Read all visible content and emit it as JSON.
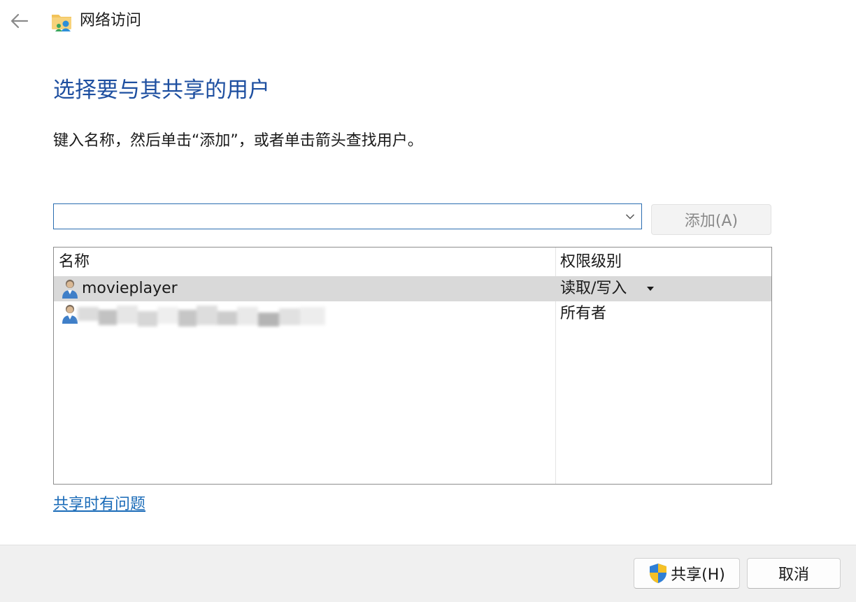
{
  "window": {
    "title": "网络访问"
  },
  "page": {
    "heading": "选择要与其共享的用户",
    "instruction": "键入名称，然后单击“添加”，或者单击箭头查找用户。"
  },
  "input": {
    "value": "",
    "placeholder": ""
  },
  "add_button": {
    "label": "添加(A)"
  },
  "table": {
    "columns": [
      "名称",
      "权限级别"
    ],
    "rows": [
      {
        "name": "movieplayer",
        "permission": "读取/写入",
        "selected": true
      },
      {
        "name": "",
        "permission": "所有者",
        "selected": false
      }
    ]
  },
  "help_link": {
    "label": "共享时有问题"
  },
  "footer": {
    "share_label": "共享(H)",
    "cancel_label": "取消"
  },
  "icons": {
    "back": "back-arrow-icon",
    "app": "network-folder-icon",
    "user": "user-icon",
    "shield": "uac-shield-icon",
    "dropdown": "chevron-down-icon"
  },
  "colors": {
    "heading": "#1e4fa0",
    "link": "#1a6bb8",
    "input_border": "#2a6db0",
    "selected_row": "#d9d9d9",
    "footer_bg": "#f0f0f0"
  }
}
